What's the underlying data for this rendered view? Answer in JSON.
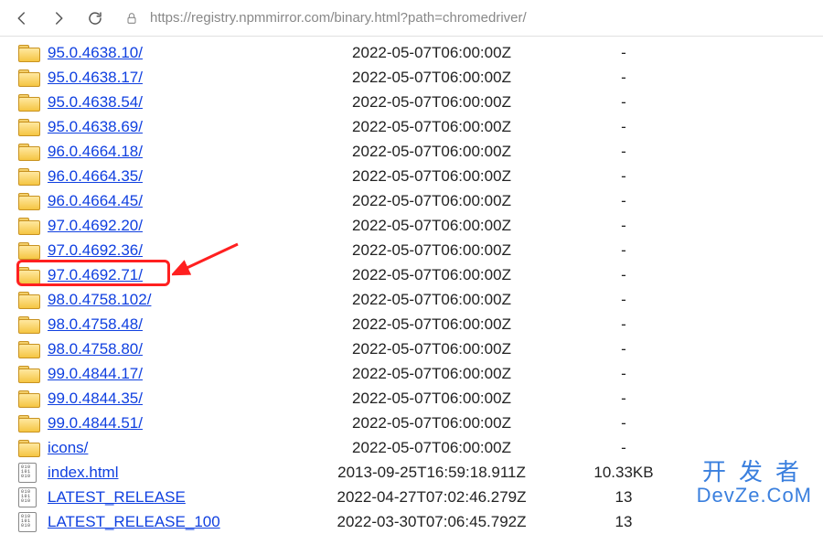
{
  "toolbar": {
    "url": "https://registry.npmmirror.com/binary.html?path=chromedriver/"
  },
  "highlight": {
    "target_index": 9
  },
  "watermark": {
    "line1": "开发者",
    "line2": "DevZe.CoM",
    "faded": ""
  },
  "rows": [
    {
      "type": "folder",
      "name": "95.0.4638.10/",
      "date": "2022-05-07T06:00:00Z",
      "size": "-"
    },
    {
      "type": "folder",
      "name": "95.0.4638.17/",
      "date": "2022-05-07T06:00:00Z",
      "size": "-"
    },
    {
      "type": "folder",
      "name": "95.0.4638.54/",
      "date": "2022-05-07T06:00:00Z",
      "size": "-"
    },
    {
      "type": "folder",
      "name": "95.0.4638.69/",
      "date": "2022-05-07T06:00:00Z",
      "size": "-"
    },
    {
      "type": "folder",
      "name": "96.0.4664.18/",
      "date": "2022-05-07T06:00:00Z",
      "size": "-"
    },
    {
      "type": "folder",
      "name": "96.0.4664.35/",
      "date": "2022-05-07T06:00:00Z",
      "size": "-"
    },
    {
      "type": "folder",
      "name": "96.0.4664.45/",
      "date": "2022-05-07T06:00:00Z",
      "size": "-"
    },
    {
      "type": "folder",
      "name": "97.0.4692.20/",
      "date": "2022-05-07T06:00:00Z",
      "size": "-"
    },
    {
      "type": "folder",
      "name": "97.0.4692.36/",
      "date": "2022-05-07T06:00:00Z",
      "size": "-"
    },
    {
      "type": "folder",
      "name": "97.0.4692.71/",
      "date": "2022-05-07T06:00:00Z",
      "size": "-"
    },
    {
      "type": "folder",
      "name": "98.0.4758.102/",
      "date": "2022-05-07T06:00:00Z",
      "size": "-"
    },
    {
      "type": "folder",
      "name": "98.0.4758.48/",
      "date": "2022-05-07T06:00:00Z",
      "size": "-"
    },
    {
      "type": "folder",
      "name": "98.0.4758.80/",
      "date": "2022-05-07T06:00:00Z",
      "size": "-"
    },
    {
      "type": "folder",
      "name": "99.0.4844.17/",
      "date": "2022-05-07T06:00:00Z",
      "size": "-"
    },
    {
      "type": "folder",
      "name": "99.0.4844.35/",
      "date": "2022-05-07T06:00:00Z",
      "size": "-"
    },
    {
      "type": "folder",
      "name": "99.0.4844.51/",
      "date": "2022-05-07T06:00:00Z",
      "size": "-"
    },
    {
      "type": "folder",
      "name": "icons/",
      "date": "2022-05-07T06:00:00Z",
      "size": "-"
    },
    {
      "type": "file",
      "name": "index.html",
      "date": "2013-09-25T16:59:18.911Z",
      "size": "10.33KB"
    },
    {
      "type": "file",
      "name": "LATEST_RELEASE",
      "date": "2022-04-27T07:02:46.279Z",
      "size": "13"
    },
    {
      "type": "file",
      "name": "LATEST_RELEASE_100",
      "date": "2022-03-30T07:06:45.792Z",
      "size": "13"
    }
  ]
}
